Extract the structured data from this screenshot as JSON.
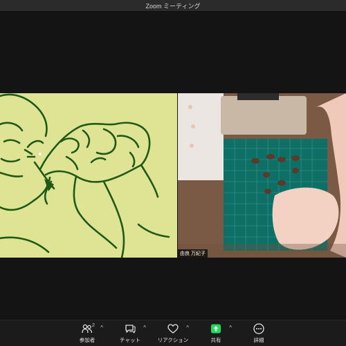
{
  "window": {
    "title": "Zoom ミーティング"
  },
  "tiles": [
    {
      "kind": "illustration",
      "name": ""
    },
    {
      "kind": "camera",
      "name": "由良 万紀子"
    }
  ],
  "toolbar": {
    "participants": {
      "label": "参加者",
      "count": "2",
      "icon": "participants-icon"
    },
    "chat": {
      "label": "チャット",
      "icon": "chat-icon"
    },
    "reactions": {
      "label": "リアクション",
      "icon": "heart-icon"
    },
    "share": {
      "label": "共有",
      "icon": "share-screen-icon",
      "color": "#23d959"
    },
    "more": {
      "label": "詳細",
      "icon": "more-icon"
    },
    "caret": "^"
  }
}
